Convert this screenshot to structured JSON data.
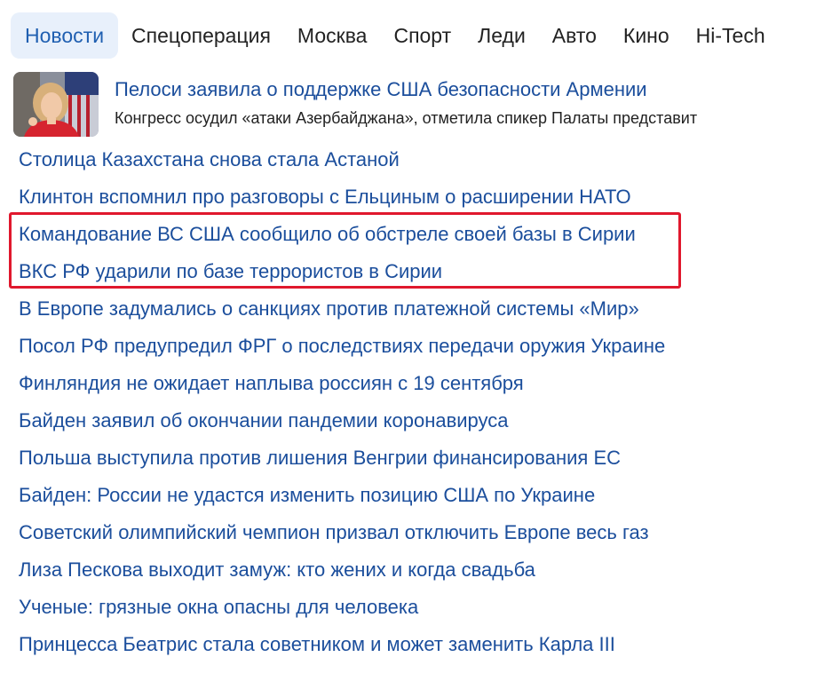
{
  "tabs": [
    {
      "label": "Новости",
      "active": true
    },
    {
      "label": "Спецоперация"
    },
    {
      "label": "Москва"
    },
    {
      "label": "Спорт"
    },
    {
      "label": "Леди"
    },
    {
      "label": "Авто"
    },
    {
      "label": "Кино"
    },
    {
      "label": "Hi-Tech"
    }
  ],
  "featured": {
    "title": "Пелоси заявила о поддержке США безопасности Армении",
    "subtitle": "Конгресс осудил «атаки Азербайджана», отметила спикер Палаты представит"
  },
  "news": [
    "Столица Казахстана снова стала Астаной",
    "Клинтон вспомнил про разговоры с Ельциным о расширении НАТО",
    "Командование ВС США сообщило об обстреле своей базы в Сирии",
    "ВКС РФ ударили по базе террористов в Сирии",
    "В Европе задумались о санкциях против платежной системы «Мир»",
    "Посол РФ предупредил ФРГ о последствиях передачи оружия Украине",
    "Финляндия не ожидает наплыва россиян с 19 сентября",
    "Байден заявил об окончании пандемии коронавируса",
    "Польша выступила против лишения Венгрии финансирования ЕС",
    "Байден: России не удастся изменить позицию США по Украине",
    "Советский олимпийский чемпион призвал отключить Европе весь газ",
    "Лиза Пескова выходит замуж: кто жених и когда свадьба",
    "Ученые: грязные окна опасны для человека",
    "Принцесса Беатрис стала советником и может заменить Карла III"
  ],
  "colors": {
    "link": "#1b4e9c",
    "active_tab_bg": "#e8f0fb",
    "active_tab_text": "#1f5fb1",
    "highlight": "#e0182d"
  }
}
